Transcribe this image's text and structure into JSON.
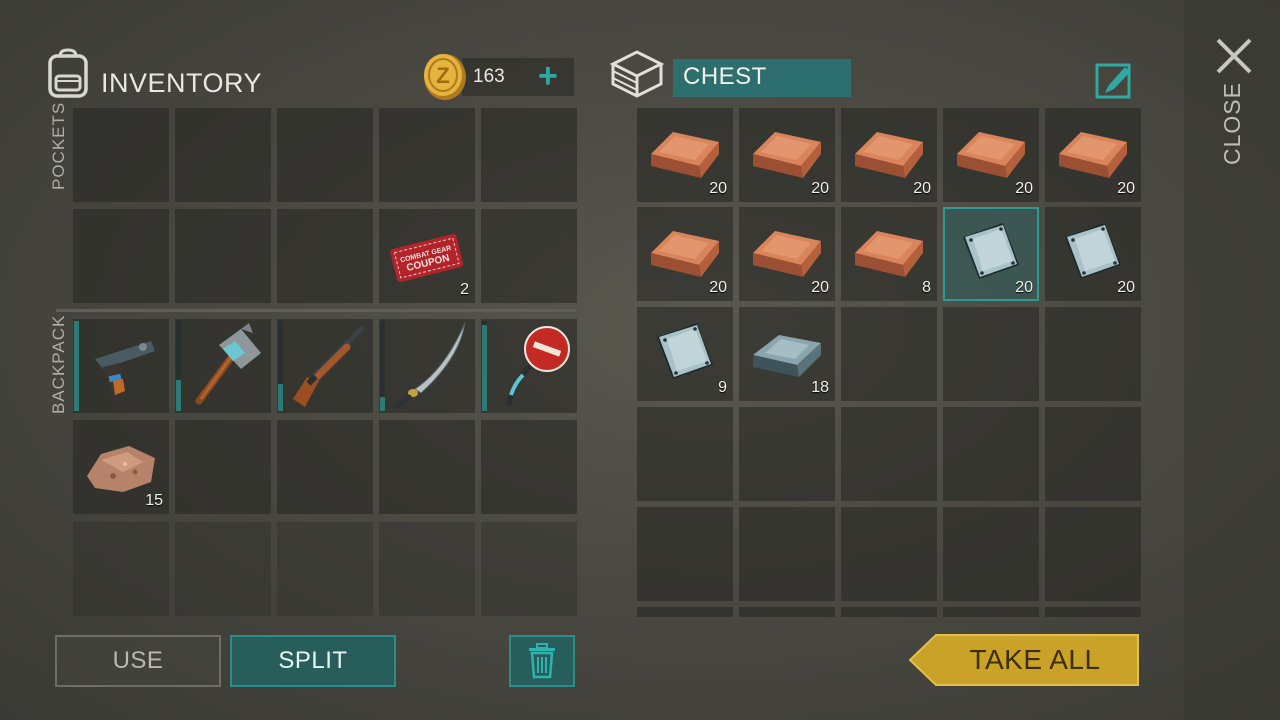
{
  "inventory": {
    "title": "INVENTORY",
    "coins": "163",
    "pockets_label": "POCKETS",
    "backpack_label": "BACKPACK",
    "pockets": [
      {
        "item": null
      },
      {
        "item": null
      },
      {
        "item": null
      },
      {
        "item": null
      },
      {
        "item": null
      },
      {
        "item": null
      },
      {
        "item": null
      },
      {
        "item": null
      },
      {
        "item": "combat-gear-coupon",
        "count": "2",
        "text": "COMBAT GEAR COUPON"
      },
      {
        "item": null
      }
    ],
    "backpack": [
      {
        "item": "pistol",
        "durability": 1.0
      },
      {
        "item": "hammer",
        "durability": 0.35
      },
      {
        "item": "shotgun",
        "durability": 0.3
      },
      {
        "item": "katana",
        "durability": 0.15
      },
      {
        "item": "stop-sign-axe",
        "durability": 0.95
      },
      {
        "item": "ore",
        "count": "15"
      },
      {
        "item": null
      },
      {
        "item": null
      },
      {
        "item": null
      },
      {
        "item": null
      },
      {
        "item": null
      },
      {
        "item": null
      },
      {
        "item": null
      },
      {
        "item": null
      },
      {
        "item": null
      }
    ]
  },
  "chest": {
    "title": "CHEST",
    "slots": [
      {
        "item": "copper-ingot",
        "count": "20"
      },
      {
        "item": "copper-ingot",
        "count": "20"
      },
      {
        "item": "copper-ingot",
        "count": "20"
      },
      {
        "item": "copper-ingot",
        "count": "20"
      },
      {
        "item": "copper-ingot",
        "count": "20"
      },
      {
        "item": "copper-ingot",
        "count": "20"
      },
      {
        "item": "copper-ingot",
        "count": "20"
      },
      {
        "item": "copper-ingot",
        "count": "8"
      },
      {
        "item": "metal-plate",
        "count": "20",
        "selected": true
      },
      {
        "item": "metal-plate",
        "count": "20"
      },
      {
        "item": "metal-plate",
        "count": "9"
      },
      {
        "item": "iron-ingot",
        "count": "18"
      },
      {
        "item": null
      },
      {
        "item": null
      },
      {
        "item": null
      },
      {
        "item": null
      },
      {
        "item": null
      },
      {
        "item": null
      },
      {
        "item": null
      },
      {
        "item": null
      },
      {
        "item": null
      },
      {
        "item": null
      },
      {
        "item": null
      },
      {
        "item": null
      },
      {
        "item": null
      },
      {
        "item": null
      },
      {
        "item": null
      },
      {
        "item": null
      },
      {
        "item": null
      },
      {
        "item": null
      }
    ]
  },
  "buttons": {
    "use": "USE",
    "split": "SPLIT",
    "take_all": "TAKE ALL",
    "close": "CLOSE"
  },
  "colors": {
    "accent": "#2d6f6e",
    "take_all": "#c9a227"
  }
}
